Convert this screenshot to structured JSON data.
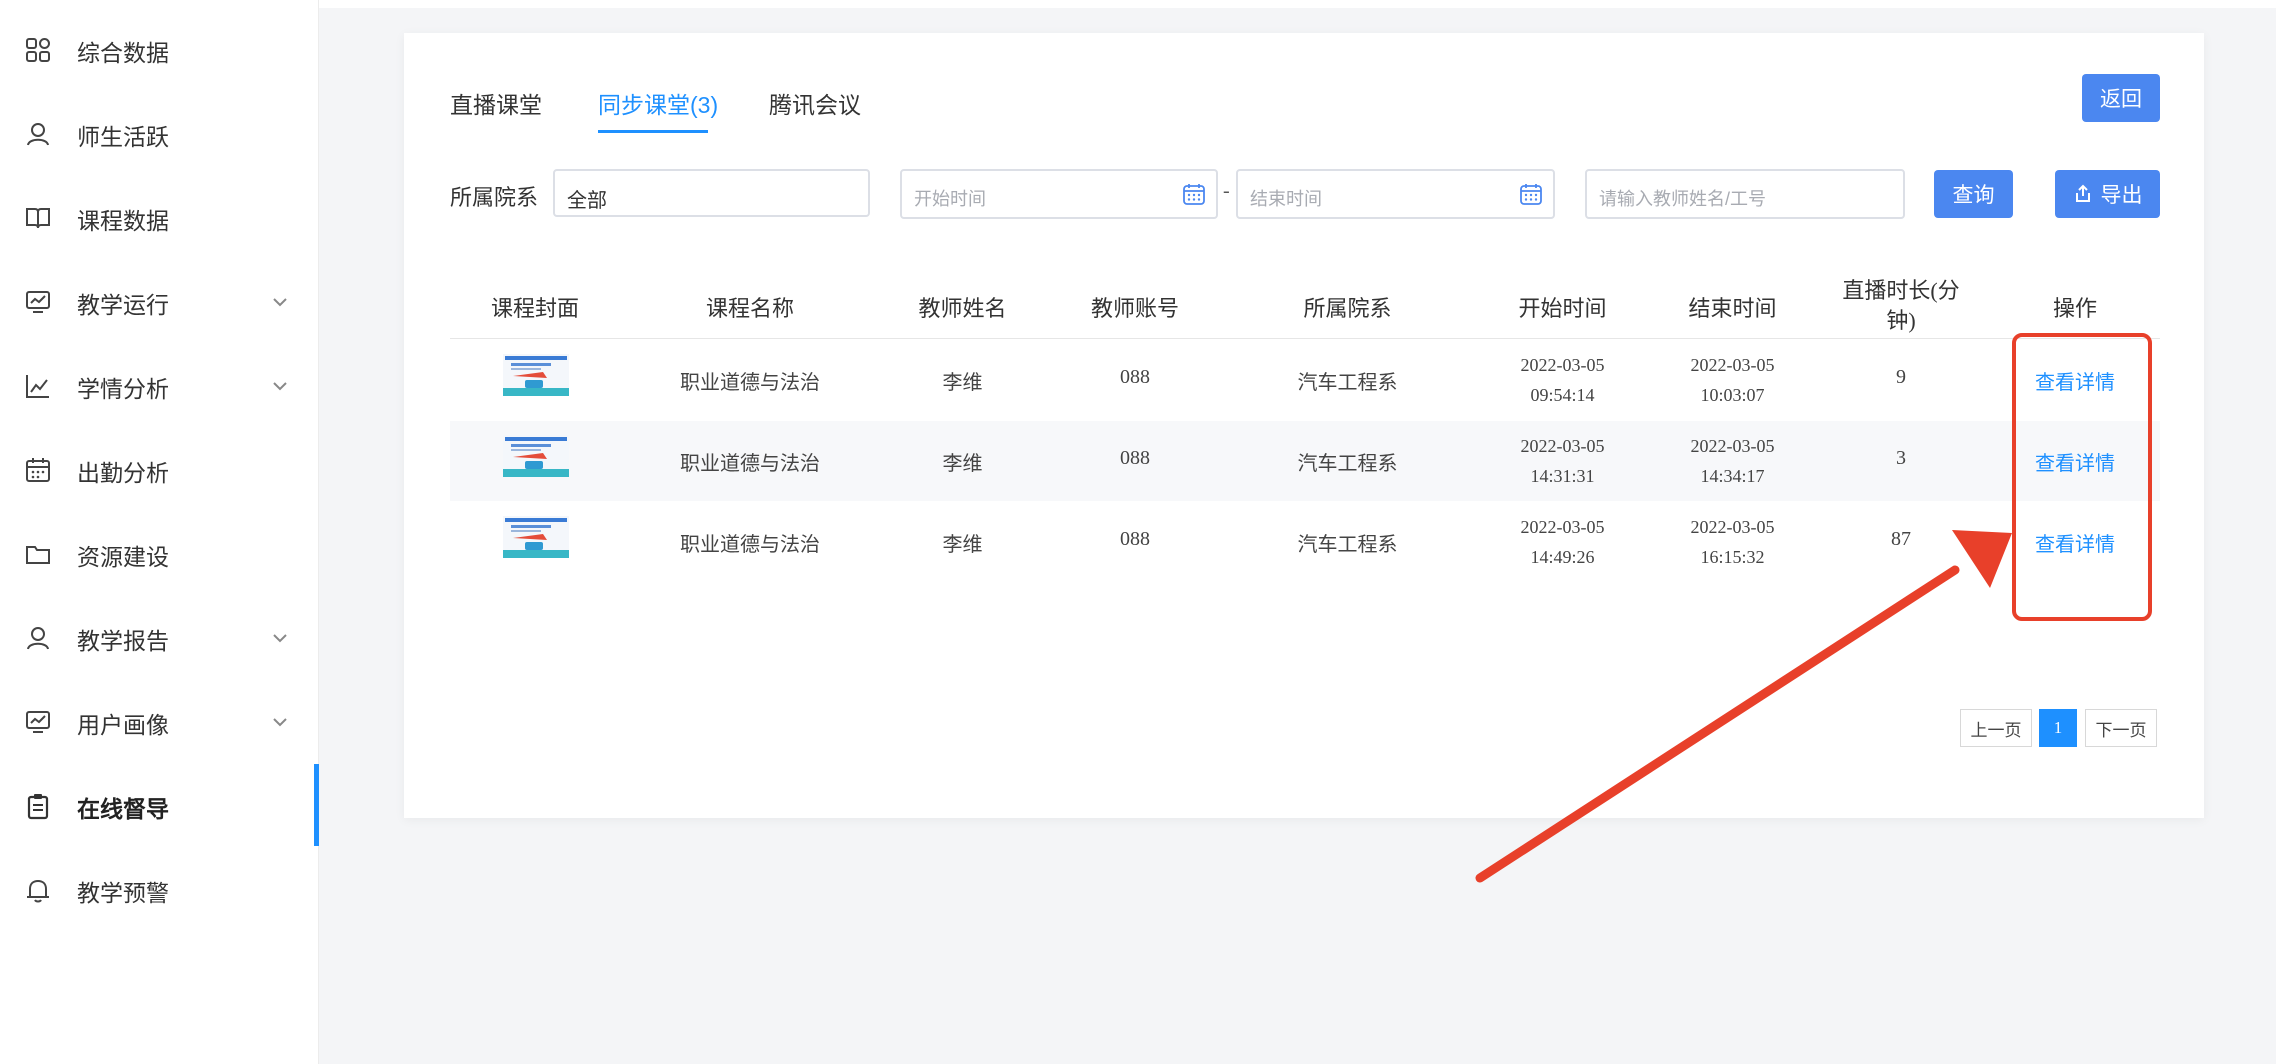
{
  "sidebar": {
    "items": [
      {
        "label": "综合数据",
        "icon": "grid-icon",
        "chevron": false
      },
      {
        "label": "师生活跃",
        "icon": "user-icon",
        "chevron": false
      },
      {
        "label": "课程数据",
        "icon": "book-icon",
        "chevron": false
      },
      {
        "label": "教学运行",
        "icon": "monitor-chart-icon",
        "chevron": true
      },
      {
        "label": "学情分析",
        "icon": "line-chart-icon",
        "chevron": true
      },
      {
        "label": "出勤分析",
        "icon": "calendar-icon",
        "chevron": false
      },
      {
        "label": "资源建设",
        "icon": "folder-icon",
        "chevron": false
      },
      {
        "label": "教学报告",
        "icon": "user-icon",
        "chevron": true
      },
      {
        "label": "用户画像",
        "icon": "monitor-chart-icon",
        "chevron": true
      },
      {
        "label": "在线督导",
        "icon": "clipboard-icon",
        "chevron": false,
        "active": true
      },
      {
        "label": "教学预警",
        "icon": "bell-icon",
        "chevron": false
      }
    ]
  },
  "tabs": [
    {
      "label": "直播课堂"
    },
    {
      "label": "同步课堂(3)",
      "active": true
    },
    {
      "label": "腾讯会议"
    }
  ],
  "back_button": "返回",
  "filters": {
    "department_label": "所属院系",
    "department_value": "全部",
    "start_placeholder": "开始时间",
    "range_separator": "-",
    "end_placeholder": "结束时间",
    "search_placeholder": "请输入教师姓名/工号",
    "query_button": "查询",
    "export_button": "导出"
  },
  "table": {
    "headers": [
      "课程封面",
      "课程名称",
      "教师姓名",
      "教师账号",
      "所属院系",
      "开始时间",
      "结束时间",
      "直播时长(分钟)",
      "操作"
    ],
    "rows": [
      {
        "name": "职业道德与法治",
        "teacher": "李维",
        "account": "088",
        "dept": "汽车工程系",
        "start_date": "2022-03-05",
        "start_time": "09:54:14",
        "end_date": "2022-03-05",
        "end_time": "10:03:07",
        "duration": "9",
        "action": "查看详情"
      },
      {
        "name": "职业道德与法治",
        "teacher": "李维",
        "account": "088",
        "dept": "汽车工程系",
        "start_date": "2022-03-05",
        "start_time": "14:31:31",
        "end_date": "2022-03-05",
        "end_time": "14:34:17",
        "duration": "3",
        "action": "查看详情"
      },
      {
        "name": "职业道德与法治",
        "teacher": "李维",
        "account": "088",
        "dept": "汽车工程系",
        "start_date": "2022-03-05",
        "start_time": "14:49:26",
        "end_date": "2022-03-05",
        "end_time": "16:15:32",
        "duration": "87",
        "action": "查看详情"
      }
    ]
  },
  "pagination": {
    "prev": "上一页",
    "current": "1",
    "next": "下一页"
  },
  "colors": {
    "accent": "#1e90ff",
    "button": "#4b87f0",
    "annotation": "#e8402a"
  }
}
